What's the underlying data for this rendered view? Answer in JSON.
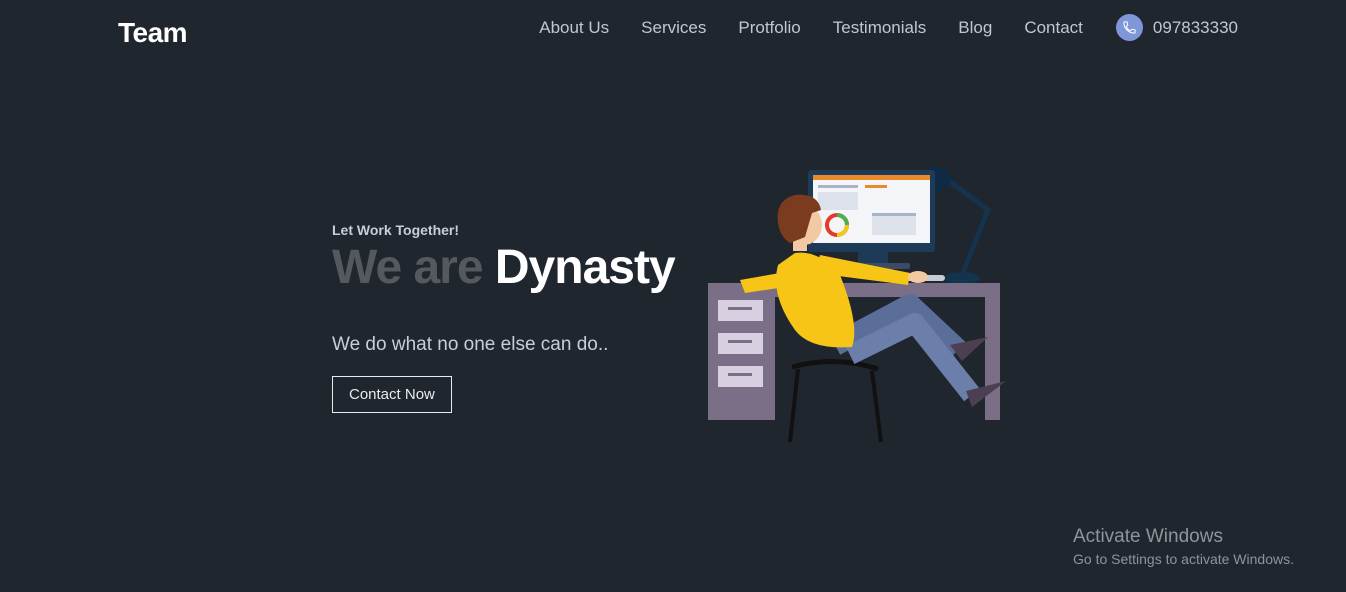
{
  "brand": {
    "logo_text": "Team"
  },
  "nav": {
    "items": [
      {
        "label": "About Us"
      },
      {
        "label": "Services"
      },
      {
        "label": "Protfolio"
      },
      {
        "label": "Testimonials"
      },
      {
        "label": "Blog"
      },
      {
        "label": "Contact"
      }
    ],
    "phone": {
      "icon": "phone-icon",
      "number": "097833330"
    }
  },
  "hero": {
    "tagline": "Let Work Together!",
    "headline_muted": "We are",
    "headline_bright": "Dynasty",
    "subline": "We do what no one else can do..",
    "cta_label": "Contact Now"
  },
  "watermark": {
    "title": "Activate Windows",
    "subtitle": "Go to Settings to activate Windows."
  },
  "colors": {
    "background": "#20262e",
    "nav_text": "#c2c7cf",
    "phone_icon_bg": "#7f97d8",
    "headline_muted": "#55585d",
    "shirt": "#f7c516"
  }
}
